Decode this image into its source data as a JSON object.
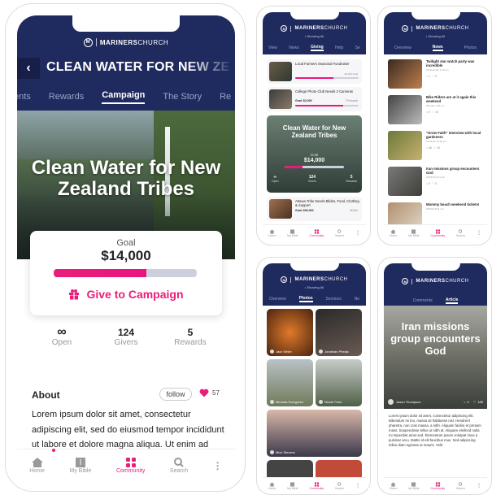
{
  "brand": {
    "name_bold": "MARINERS",
    "name_light": "CHURCH",
    "logo": "M"
  },
  "colors": {
    "navy": "#1f2a5e",
    "accent": "#e91e79"
  },
  "nav": {
    "home": "Home",
    "bible": "My Bible",
    "community": "Community",
    "search": "Search",
    "more": "⋮"
  },
  "main": {
    "back": "‹",
    "header_title": "CLEAN WATER FOR NEW ZE",
    "tabs": [
      "ents",
      "Rewards",
      "Campaign",
      "The Story",
      "Re"
    ],
    "hero_title": "Clean Water for New Zealand Tribes",
    "goal_label": "Goal",
    "goal_amount": "$14,000",
    "goal_progress": 0.65,
    "give_label": "Give to Campaign",
    "stats": [
      {
        "value": "∞",
        "label": "Open"
      },
      {
        "value": "124",
        "label": "Givers"
      },
      {
        "value": "5",
        "label": "Rewards"
      }
    ],
    "about_title": "About",
    "follow": "follow",
    "likes": "57",
    "about_text": "Lorem ipsum dolor sit amet, consectetur adipiscing elit, sed do eiusmod tempor incididunt ut labore et dolore magna aliqua. Ut enim ad minim veniam, quis nostrud exercitation ullamco"
  },
  "giving": {
    "sub": "• Showing All",
    "tabs": [
      "View",
      "News",
      "Giving",
      "Help",
      "Se"
    ],
    "items": [
      {
        "title": "Local Farmers Seasonal Fundraiser",
        "meta": "$2,000 Goal",
        "progress": 0.6
      },
      {
        "title": "College Photo Club Needs 2 Cameras",
        "meta": "Goal: $2,000",
        "meta2": "2 Rewards",
        "progress": 0.75
      }
    ],
    "featured": {
      "title": "Clean Water for New Zealand Tribes",
      "goal_label": "Goal",
      "goal": "$14,000",
      "progress": 0.3,
      "stats": [
        {
          "v": "∞",
          "l": "Open"
        },
        {
          "v": "124",
          "l": "Givers"
        },
        {
          "v": "5",
          "l": "Rewards"
        }
      ]
    },
    "last": {
      "title": "Attawa Tribe Needs Bibles, Food, Clothing & Support",
      "meta": "Goal: $30,000",
      "meta2": "$8,840"
    }
  },
  "news": {
    "sub": "• Showing All",
    "tabs": [
      "Overview",
      "News",
      "Photos"
    ],
    "items": [
      {
        "title": "Twilight star watch party was incredible",
        "date": "Wednesday 2:19 pm",
        "c": "1",
        "l": "5"
      },
      {
        "title": "Bike Riders are at it again this weekend",
        "date": "Monday 4:32 pm",
        "c": "0",
        "l": "10"
      },
      {
        "title": "\"Grow Faith\" interview with local gardeners",
        "date": "10/01/22 12:15 pm",
        "c": "46",
        "l": "10"
      },
      {
        "title": "Iran missions group encounters God",
        "date": "10/01/22 9:11 am",
        "c": "0",
        "l": "5"
      },
      {
        "title": "Mommy beach weekend tickets!",
        "date": "9/30/22 8:41 am",
        "c": "",
        "l": ""
      }
    ]
  },
  "photos": {
    "sub": "• Showing All",
    "tabs": [
      "Overview",
      "Photos",
      "Services",
      "Ne"
    ],
    "labels": [
      "Jack White",
      "Jonathan Phelps",
      "Miranda Evergreen",
      "Nicole Fahs",
      "Mick Stevens"
    ]
  },
  "article": {
    "sub": "• Showing All",
    "tabs": [
      "Comments",
      "Article"
    ],
    "hero_title": "Iran missions group encounters God",
    "author": "Jason Thompson",
    "comments": "0",
    "likes": "185",
    "text": "Lorem ipsum dolor sit amet, consectetur adipiscing elit. Bibendum mi leo, massa sit habitasse nisl. Hendrerit pharetra, non cras massa, a nibh. Aliquam facilisi et pretium mass. Suspendisse tellus ut nibh at. Aliquam eleifend nulla mi imperdiet amet sed. Elementum ipsum volutpat risus a pulvinar arcu. Mattis id elit faucibus mus. Sed adipiscing tellus diam egestas ut mauris. Velit"
  }
}
